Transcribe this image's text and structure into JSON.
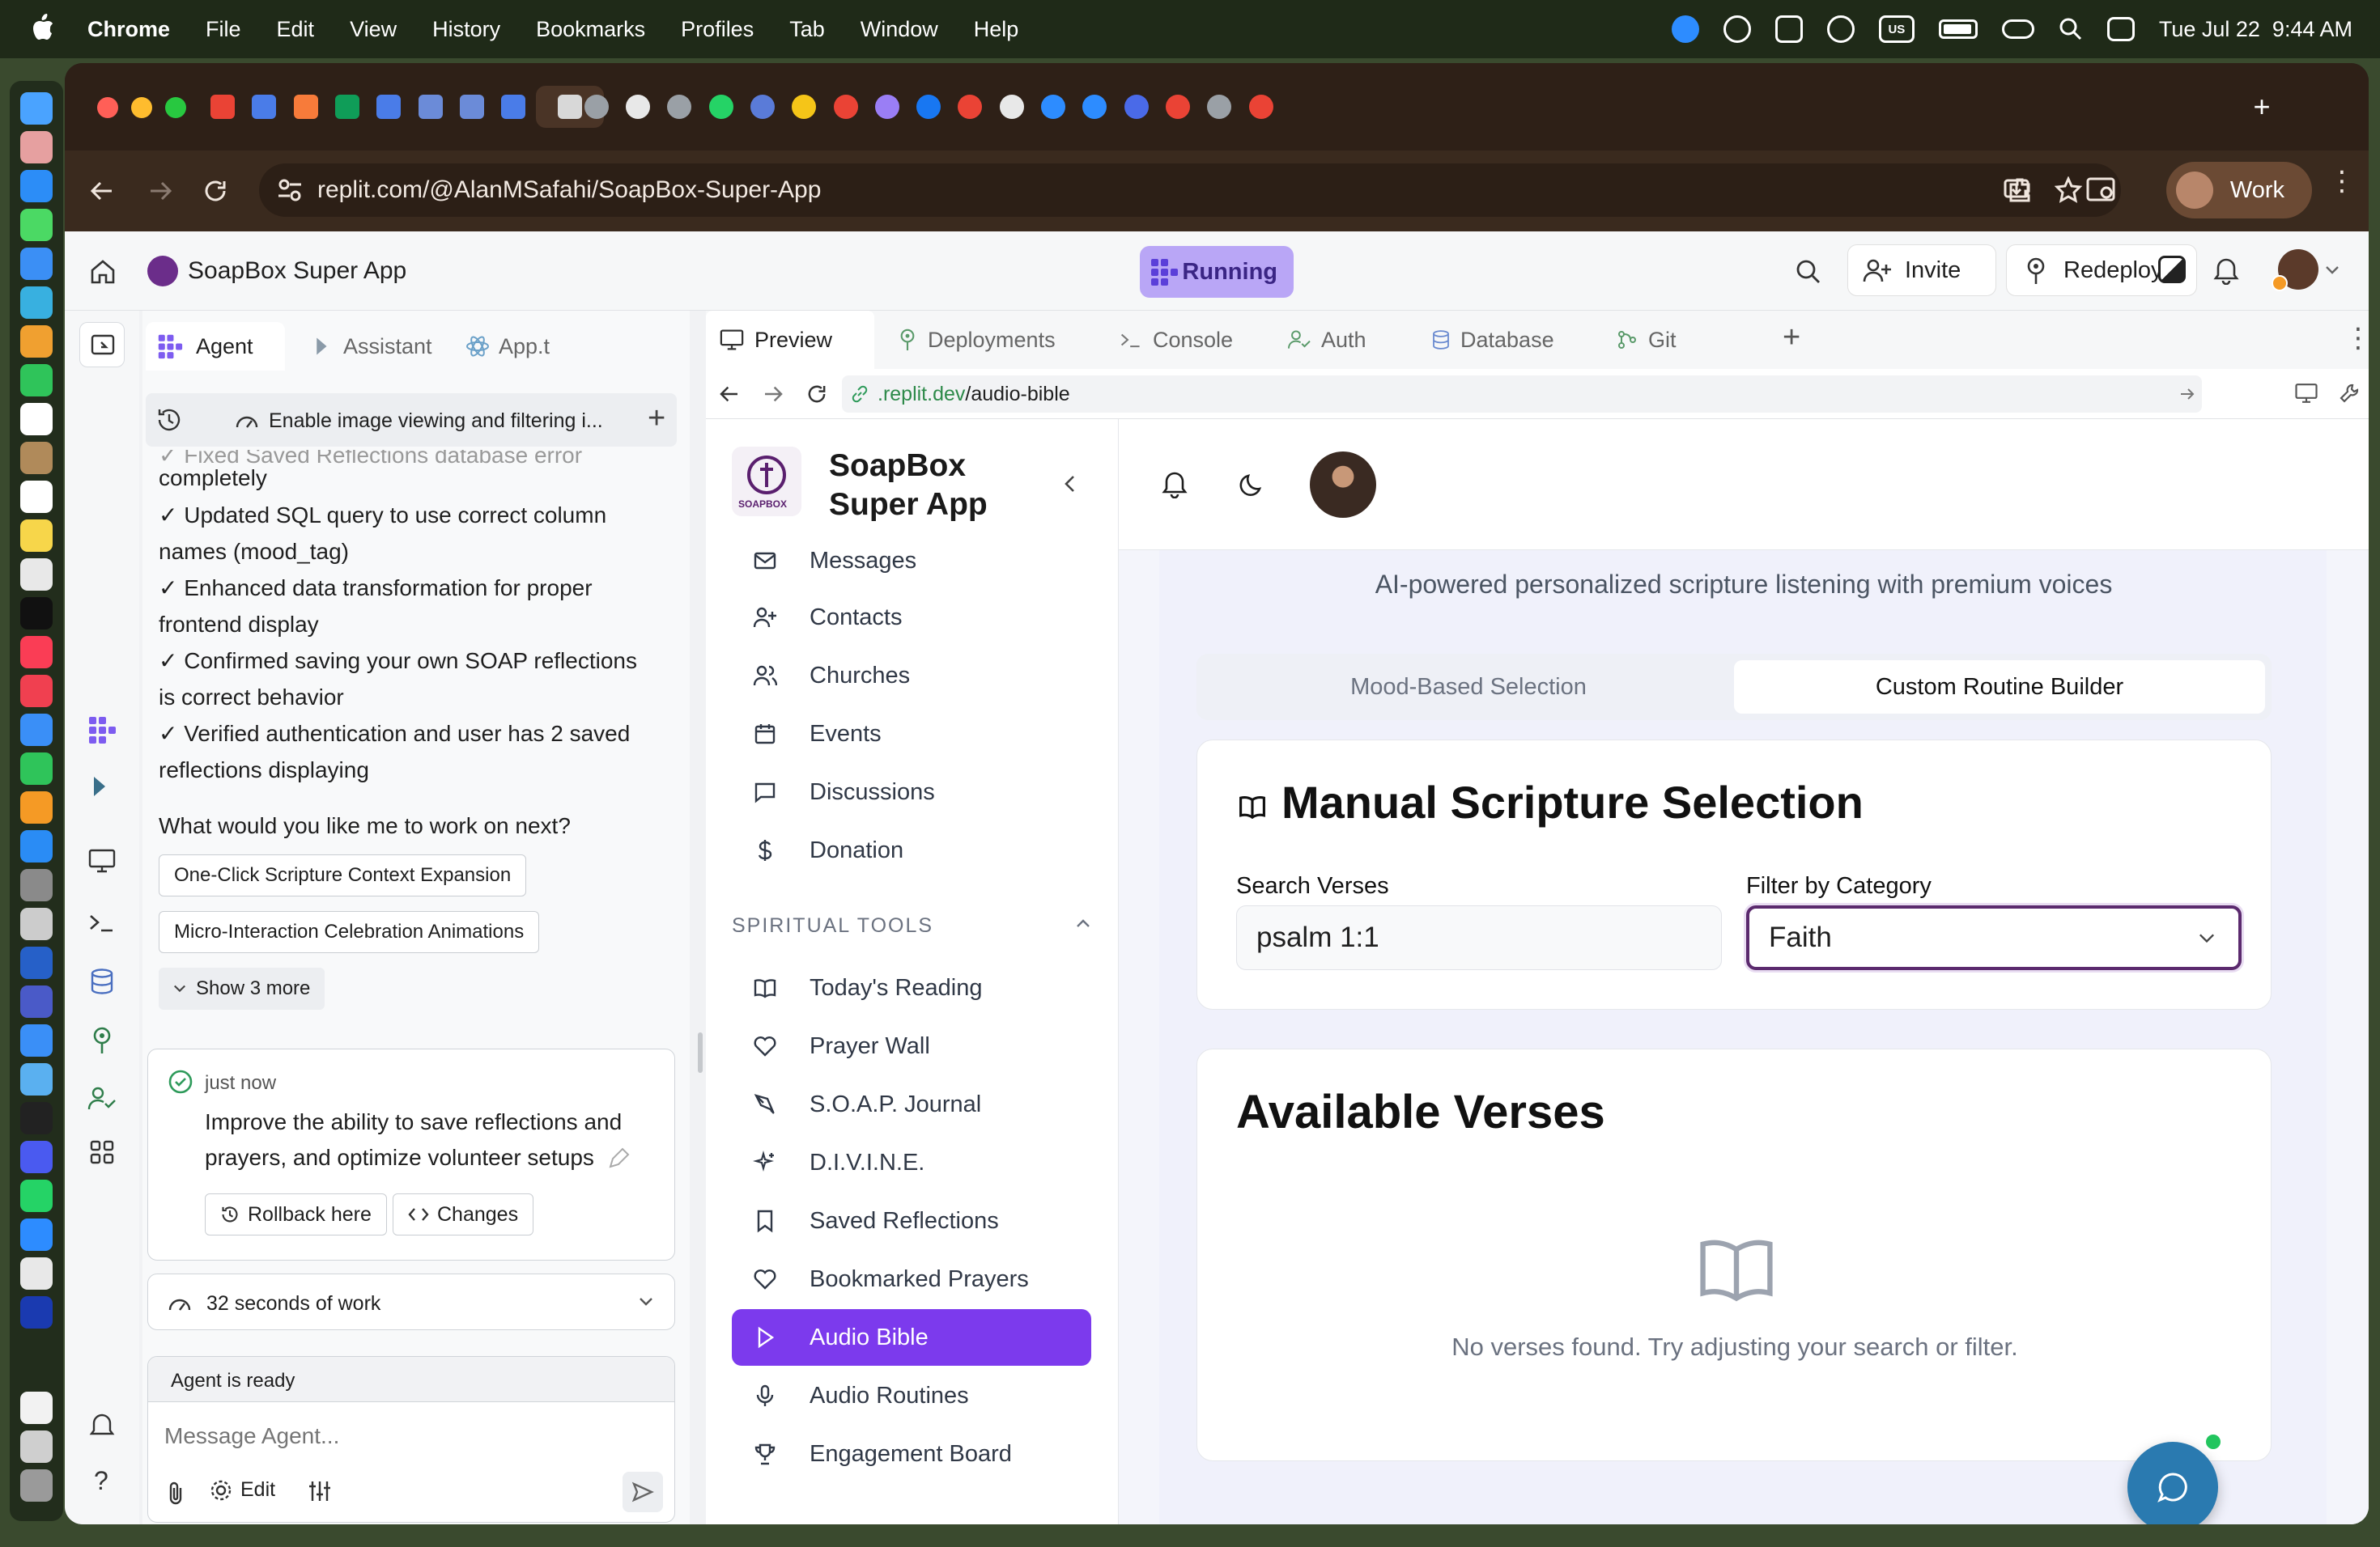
{
  "os_menubar": {
    "app_name": "Chrome",
    "menus": [
      "File",
      "Edit",
      "View",
      "History",
      "Bookmarks",
      "Profiles",
      "Tab",
      "Window",
      "Help"
    ],
    "keyboard_layout": "US",
    "datetime": "Tue Jul 22  9:44 AM"
  },
  "browser": {
    "url": "replit.com/@AlanMSafahi/SoapBox-Super-App",
    "profile_label": "Work",
    "tab_colors": [
      "#ea4335",
      "#4a7ce8",
      "#f77b3a",
      "#0f9d58",
      "#4a7ce8",
      "#6b8bd8",
      "#6b8bd8",
      "#4a7ce8",
      "#d8d8d8",
      "#9aa0a6",
      "#e8e8e8",
      "#9aa0a6",
      "#25d366",
      "#5a7bd8",
      "#f5c518",
      "#ea4335",
      "#9a7ef5",
      "#1877f2",
      "#ea4335",
      "#e8e8e8",
      "#2d8cff",
      "#2d8cff",
      "#4a6ae8",
      "#ea4335",
      "#9aa0a6",
      "#ea4335"
    ]
  },
  "replit": {
    "project_name": "SoapBox Super App",
    "status": "Running",
    "invite_label": "Invite",
    "redeploy_label": "Redeploy",
    "left_tabs": [
      "Agent",
      "Assistant",
      "App.t"
    ],
    "history_title": "Enable image viewing and filtering i...",
    "chat": {
      "faded_line": "✓ Fixed Saved Reflections database error",
      "lines": [
        "completely",
        "✓ Updated SQL query to use correct column names (mood_tag)",
        "✓ Enhanced data transformation for proper frontend display",
        "✓ Confirmed saving your own SOAP reflections is correct behavior",
        "✓ Verified authentication and user has 2 saved reflections displaying"
      ],
      "question": "What would you like me to work on next?",
      "suggestions": [
        "One-Click Scripture Context Expansion",
        "Micro-Interaction Celebration Animations"
      ],
      "show_more": "Show 3 more",
      "checkpoint": {
        "time": "just now",
        "message": "Improve the ability to save reflections and prayers, and optimize volunteer setups",
        "rollback_label": "Rollback here",
        "changes_label": "Changes"
      },
      "work_summary": "32 seconds of work",
      "agent_status": "Agent is ready",
      "input_placeholder": "Message Agent...",
      "edit_label": "Edit"
    },
    "preview_tabs": [
      "Preview",
      "Deployments",
      "Console",
      "Auth",
      "Database",
      "Git"
    ],
    "preview_url_prefix": ".replit.dev",
    "preview_url_path": "/audio-bible"
  },
  "site": {
    "brand_line1": "SoapBox",
    "brand_line2": "Super App",
    "logo_text": "SOAPBOX",
    "nav_top": [
      "Messages",
      "Contacts",
      "Churches",
      "Events",
      "Discussions",
      "Donation"
    ],
    "section_label": "SPIRITUAL TOOLS",
    "nav_tools": [
      "Today's Reading",
      "Prayer Wall",
      "S.O.A.P. Journal",
      "D.I.V.I.N.E.",
      "Saved Reflections",
      "Bookmarked Prayers",
      "Audio Bible",
      "Audio Routines",
      "Engagement Board"
    ],
    "active_nav": "Audio Bible",
    "subtitle": "AI-powered personalized scripture listening with premium voices",
    "tabs": [
      "Mood-Based Selection",
      "Custom Routine Builder"
    ],
    "active_tab": "Custom Routine Builder",
    "manual_title": "Manual Scripture Selection",
    "search_label": "Search Verses",
    "search_value": "psalm 1:1",
    "filter_label": "Filter by Category",
    "filter_value": "Faith",
    "available_title": "Available Verses",
    "empty_message": "No verses found. Try adjusting your search or filter.",
    "accent": "#7c3aed"
  }
}
